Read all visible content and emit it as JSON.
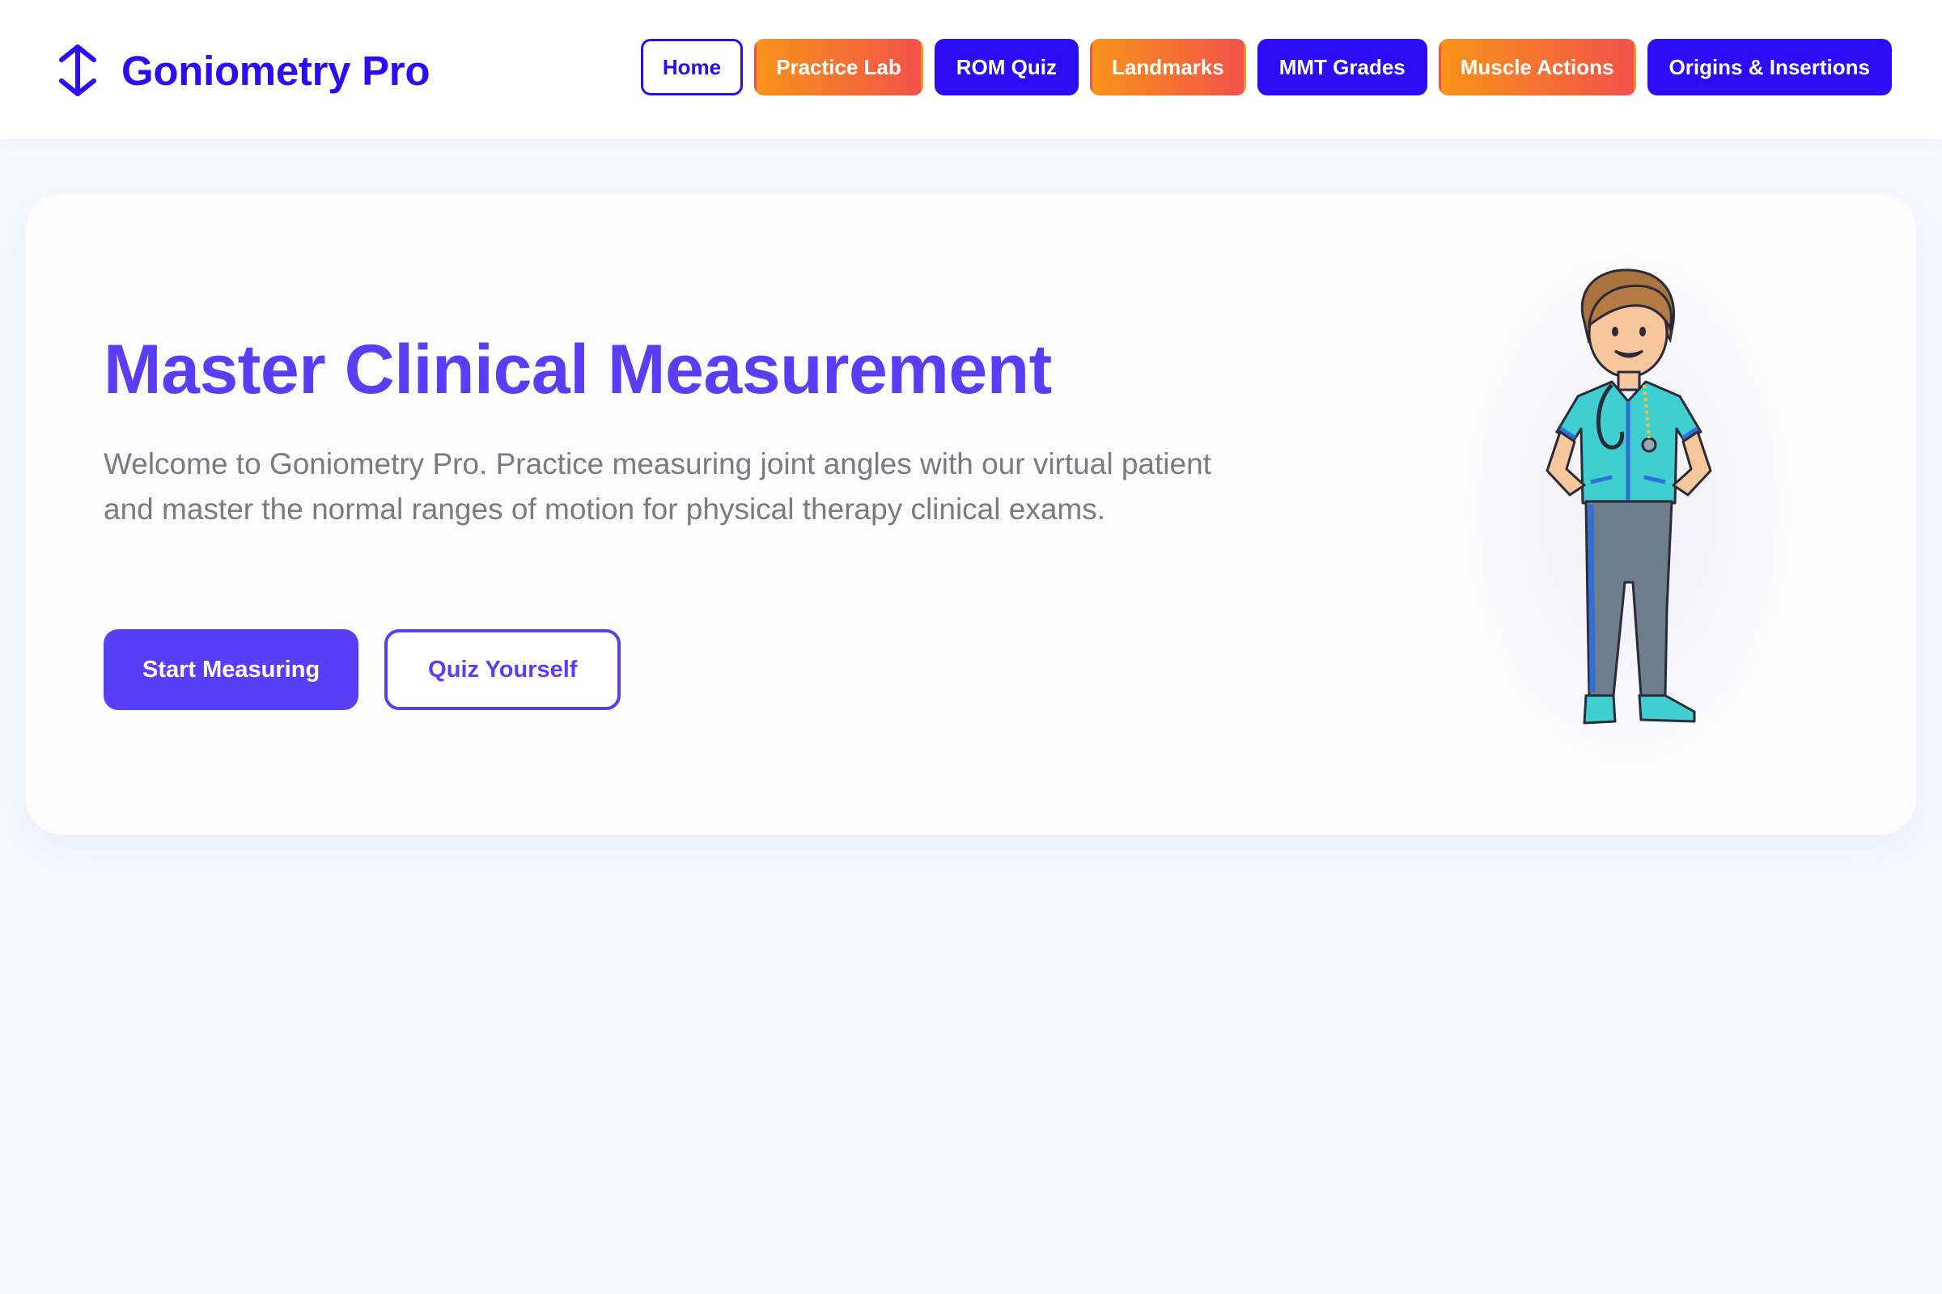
{
  "brand": {
    "name": "Goniometry Pro",
    "icon": "up-down-arrows-icon",
    "color": "#2a0df2"
  },
  "nav": {
    "items": [
      {
        "label": "Home",
        "style": "outline"
      },
      {
        "label": "Practice Lab",
        "style": "orange-gradient"
      },
      {
        "label": "ROM Quiz",
        "style": "blue"
      },
      {
        "label": "Landmarks",
        "style": "orange-gradient"
      },
      {
        "label": "MMT Grades",
        "style": "blue"
      },
      {
        "label": "Muscle Actions",
        "style": "orange-gradient"
      },
      {
        "label": "Origins & Insertions",
        "style": "blue"
      }
    ]
  },
  "hero": {
    "title": "Master Clinical Measurement",
    "description": "Welcome to Goniometry Pro. Practice measuring joint angles with our virtual patient and master the normal ranges of motion for physical therapy clinical exams.",
    "primary_button": "Start Measuring",
    "secondary_button": "Quiz Yourself",
    "illustration": "physical-therapist-illustration",
    "accent": "#5a3ef5"
  },
  "colors": {
    "page_background": "#f8f9ff",
    "nav_blue": "#2c0cf4",
    "nav_orange_start": "#f7931a",
    "nav_orange_end": "#f2524a",
    "body_text": "#7a7a80"
  }
}
